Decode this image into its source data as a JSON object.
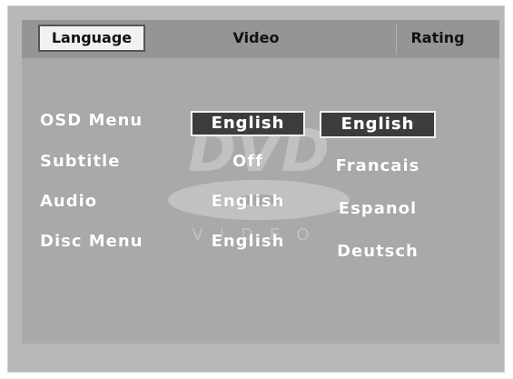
{
  "tabs": {
    "language": "Language",
    "video": "Video",
    "rating": "Rating"
  },
  "settings": {
    "osd_menu": {
      "label": "OSD Menu",
      "value": "English"
    },
    "subtitle": {
      "label": "Subtitle",
      "value": "Off"
    },
    "audio": {
      "label": "Audio",
      "value": "English"
    },
    "disc_menu": {
      "label": "Disc Menu",
      "value": "English"
    }
  },
  "options": [
    "English",
    "Francais",
    "Espanol",
    "Deutsch"
  ],
  "watermark": {
    "logo_text": "DVD",
    "sub_text": "VIDEO"
  },
  "colors": {
    "screen_bg": "#a9a9a9",
    "tab_bar_bg": "#959595",
    "selected_bg": "#3c3c3c",
    "active_tab_bg": "#f1f1f1",
    "text": "#ffffff"
  }
}
